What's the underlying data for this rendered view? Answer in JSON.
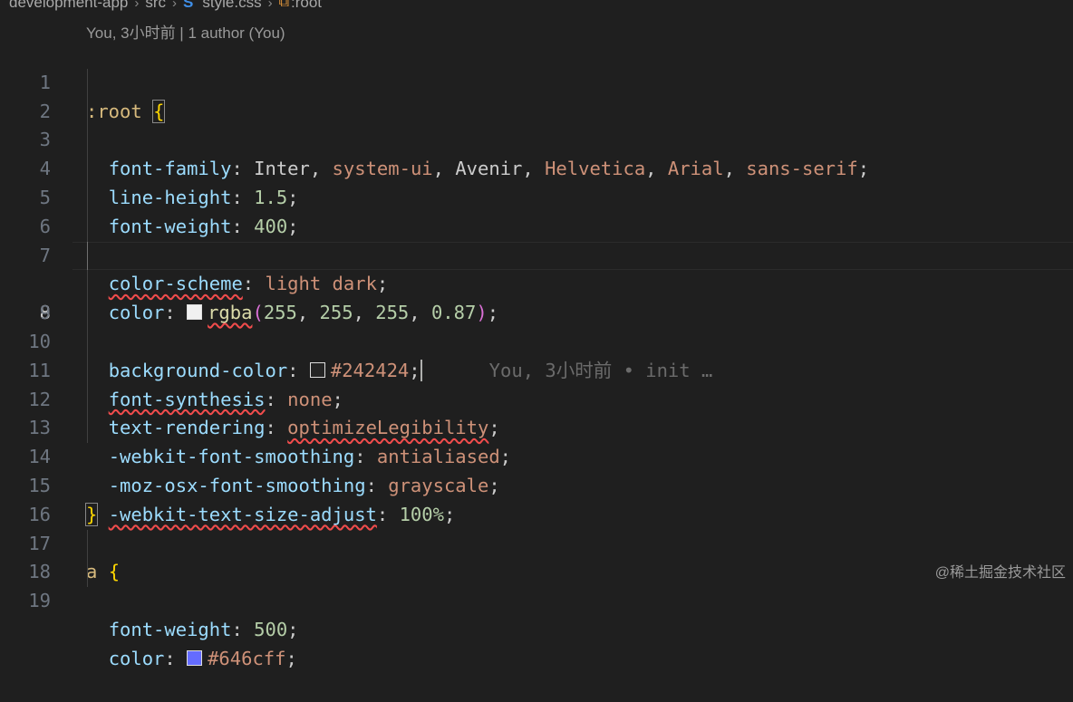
{
  "breadcrumb": {
    "items": [
      "development-app",
      "src",
      "style.css",
      ":root"
    ],
    "css_icon": "S",
    "selector_icon": "⧉"
  },
  "blame_header": "You, 3小时前 | 1 author (You)",
  "inline_blame": "You, 3小时前 • init …",
  "line_numbers": [
    "1",
    "2",
    "3",
    "4",
    "5",
    "6",
    "7",
    "8",
    "9",
    "10",
    "11",
    "12",
    "13",
    "14",
    "15",
    "16",
    "17",
    "18",
    "19"
  ],
  "code": {
    "l1_selector": ":root",
    "brace_open": "{",
    "brace_close": "}",
    "l2_prop": "font-family",
    "l2_vals": [
      "Inter",
      "system-ui",
      "Avenir",
      "Helvetica",
      "Arial",
      "sans-serif"
    ],
    "l3_prop": "line-height",
    "l3_val": "1.5",
    "l4_prop": "font-weight",
    "l4_val": "400",
    "l6_prop": "color-scheme",
    "l6_val1": "light",
    "l6_val2": "dark",
    "l7_prop": "color",
    "l7_fn": "rgba",
    "l7_nums": [
      "255",
      "255",
      "255",
      "0.87"
    ],
    "l8_prop": "background-color",
    "l8_val": "#242424",
    "l10_prop": "font-synthesis",
    "l10_val": "none",
    "l11_prop": "text-rendering",
    "l11_val": "optimizeLegibility",
    "l12_prop": "-webkit-font-smoothing",
    "l12_val": "antialiased",
    "l13_prop": "-moz-osx-font-smoothing",
    "l13_val": "grayscale",
    "l14_prop": "-webkit-text-size-adjust",
    "l14_val": "100%",
    "l17_selector": "a",
    "l18_prop": "font-weight",
    "l18_val": "500",
    "l19_prop": "color",
    "l19_val": "#646cff"
  },
  "swatches": {
    "color": "#f0f0f0",
    "background": "#242424",
    "link": "#646cff"
  },
  "watermark": "@稀土掘金技术社区",
  "colors": {
    "editor_bg": "#1f1f1f",
    "property": "#9cdcfe",
    "value": "#ce9178",
    "number": "#b5cea8",
    "selector": "#d7ba7d",
    "brace": "#ffd700"
  }
}
